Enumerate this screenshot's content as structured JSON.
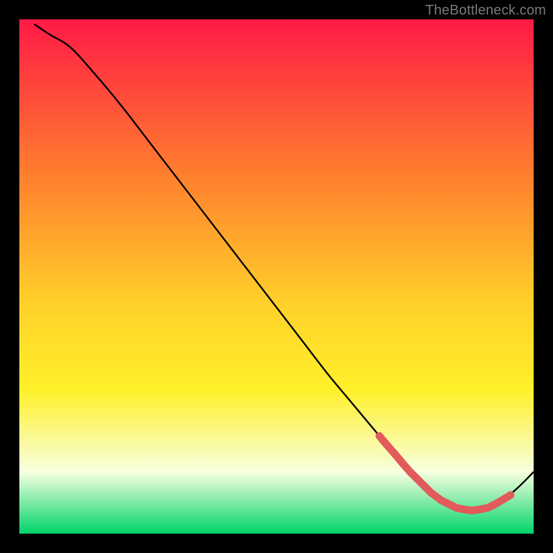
{
  "watermark": "TheBottleneck.com",
  "colors": {
    "background": "#000000",
    "gradient_top": "#ff1a46",
    "gradient_mid1": "#ff7e2e",
    "gradient_mid2": "#ffd02a",
    "gradient_mid3": "#fff02a",
    "gradient_low_pale": "#f7ffe0",
    "gradient_bottom": "#00d46a",
    "curve": "#000000",
    "markers": "#e35a5a",
    "frame": "#000000",
    "watermark": "#7a7a7a"
  },
  "chart_data": {
    "type": "line",
    "title": "",
    "xlabel": "",
    "ylabel": "",
    "xlim": [
      0,
      100
    ],
    "ylim": [
      0,
      100
    ],
    "legend": false,
    "comment": "Plot area is a vertical red→yellow→green gradient; black curve starts near top-left, descends roughly linearly to a trough ~x=80–88, then rises toward bottom-right corner. Salmon round markers/segments cluster along the curve between roughly x=70 and x=95.",
    "series": [
      {
        "name": "curve",
        "x": [
          3,
          6,
          10,
          15,
          20,
          25,
          30,
          35,
          40,
          45,
          50,
          55,
          60,
          65,
          70,
          73,
          76,
          79,
          82,
          85,
          88,
          91,
          94,
          97,
          100
        ],
        "y": [
          99,
          97,
          94.5,
          89,
          83,
          76.5,
          70,
          63.5,
          57,
          50.5,
          44,
          37.5,
          31,
          25,
          19,
          15.5,
          12,
          9,
          6.5,
          5,
          4.5,
          5,
          6.5,
          9,
          12
        ]
      }
    ],
    "markers": [
      {
        "x": 70.0,
        "y": 19.0
      },
      {
        "x": 71.5,
        "y": 17.2
      },
      {
        "x": 73.0,
        "y": 15.5
      },
      {
        "x": 74.5,
        "y": 13.7
      },
      {
        "x": 76.0,
        "y": 12.0
      },
      {
        "x": 77.0,
        "y": 11.0
      },
      {
        "x": 79.0,
        "y": 9.0
      },
      {
        "x": 80.0,
        "y": 8.0
      },
      {
        "x": 82.0,
        "y": 6.5
      },
      {
        "x": 83.0,
        "y": 6.0
      },
      {
        "x": 85.0,
        "y": 5.0
      },
      {
        "x": 86.5,
        "y": 4.7
      },
      {
        "x": 88.0,
        "y": 4.5
      },
      {
        "x": 89.5,
        "y": 4.7
      },
      {
        "x": 91.0,
        "y": 5.0
      },
      {
        "x": 92.5,
        "y": 5.7
      },
      {
        "x": 95.5,
        "y": 7.5
      }
    ]
  }
}
